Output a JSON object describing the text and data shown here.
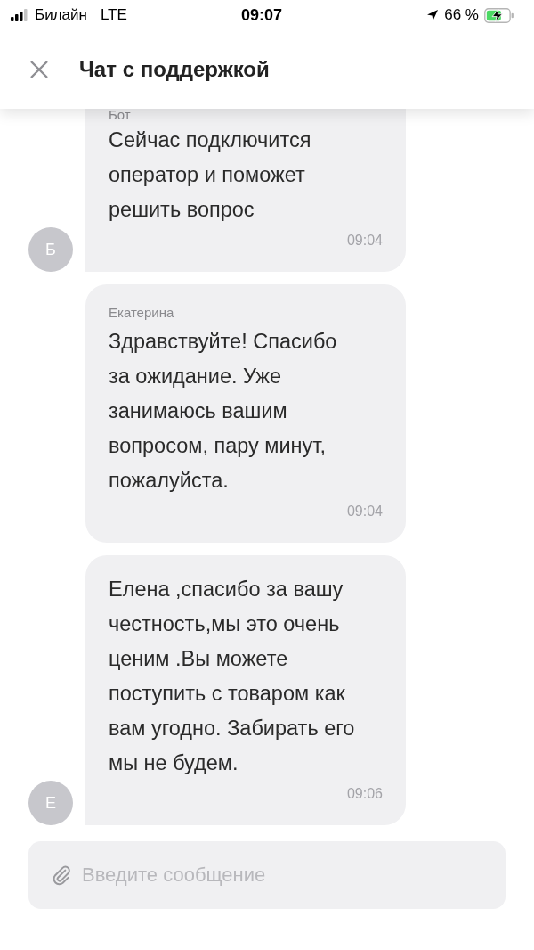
{
  "status_bar": {
    "carrier": "Билайн",
    "network": "LTE",
    "time": "09:07",
    "battery_percent": "66 %",
    "charging": true
  },
  "header": {
    "title": "Чат с поддержкой"
  },
  "messages": [
    {
      "sender": "Бот",
      "text": "Сейчас подключится оператор и поможет решить вопрос",
      "time": "09:04",
      "avatar": "Б",
      "cut": true
    },
    {
      "sender": "Екатерина",
      "text": "Здравствуйте! Спасибо за ожидание. Уже занимаюсь вашим вопросом, пару минут, пожалуйста.",
      "time": "09:04"
    },
    {
      "text": "Елена ,спасибо за вашу честность,мы это очень ценим .Вы можете поступить с товаром как вам угодно. Забирать его мы не будем.",
      "time": "09:06",
      "avatar": "Е"
    }
  ],
  "composer": {
    "placeholder": "Введите сообщение"
  }
}
